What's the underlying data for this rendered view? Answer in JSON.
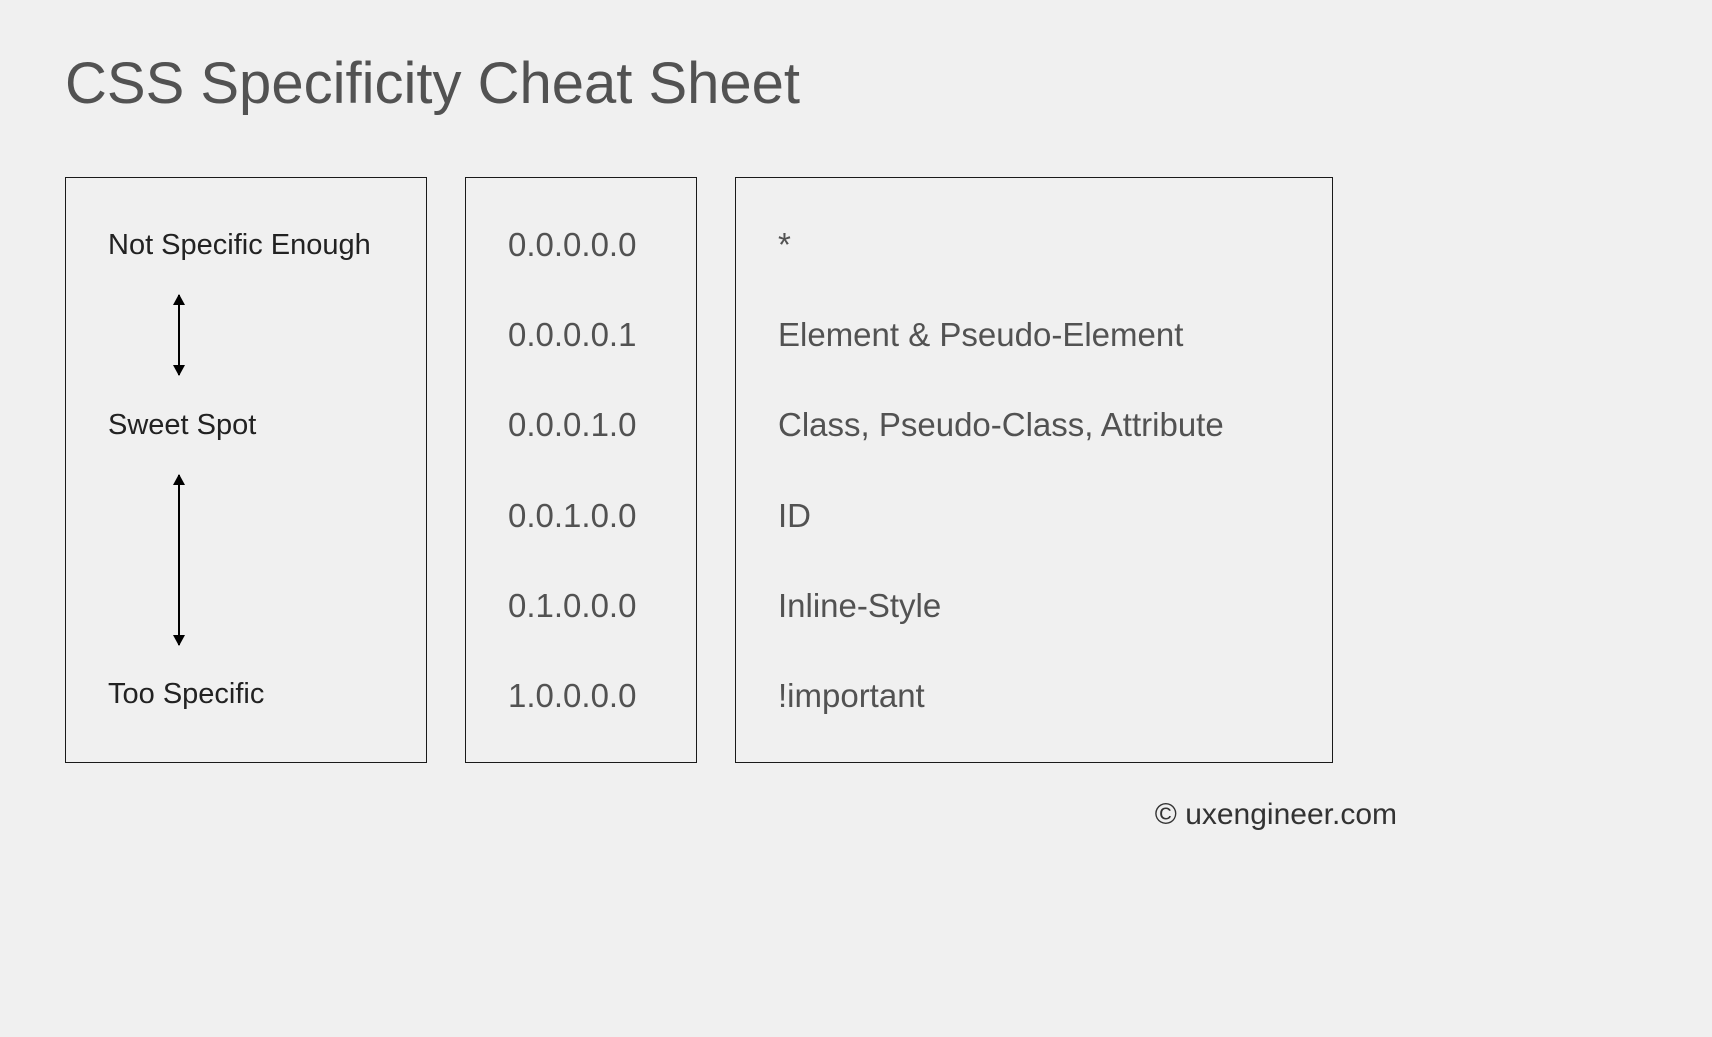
{
  "title": "CSS Specificity Cheat Sheet",
  "spectrum": {
    "low": "Not Specific Enough",
    "mid": "Sweet Spot",
    "high": "Too Specific"
  },
  "values": {
    "v0": "0.0.0.0.0",
    "v1": "0.0.0.0.1",
    "v2": "0.0.0.1.0",
    "v3": "0.0.1.0.0",
    "v4": "0.1.0.0.0",
    "v5": "1.0.0.0.0"
  },
  "descriptions": {
    "d0": "*",
    "d1": "Element & Pseudo-Element",
    "d2": "Class, Pseudo-Class, Attribute",
    "d3": "ID",
    "d4": "Inline-Style",
    "d5": "!important"
  },
  "footer": "© uxengineer.com"
}
